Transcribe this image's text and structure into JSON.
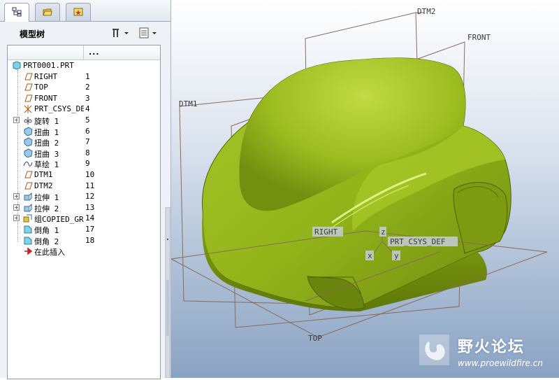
{
  "panel": {
    "title": "模型树",
    "column_header": "..."
  },
  "tree": {
    "root": "PRT0001.PRT",
    "rows": [
      {
        "label": "RIGHT",
        "num": "1",
        "icon": "datum-plane-icon",
        "expand": false
      },
      {
        "label": "TOP",
        "num": "2",
        "icon": "datum-plane-icon",
        "expand": false
      },
      {
        "label": "FRONT",
        "num": "3",
        "icon": "datum-plane-icon",
        "expand": false
      },
      {
        "label": "PRT_CSYS_DEF",
        "num": "4",
        "icon": "csys-icon",
        "expand": false
      },
      {
        "label": "旋转 1",
        "num": "5",
        "icon": "revolve-icon",
        "expand": true
      },
      {
        "label": "扭曲 1",
        "num": "6",
        "icon": "warp-icon",
        "expand": false
      },
      {
        "label": "扭曲 2",
        "num": "7",
        "icon": "warp-icon",
        "expand": false
      },
      {
        "label": "扭曲 3",
        "num": "8",
        "icon": "warp-icon",
        "expand": false
      },
      {
        "label": "草绘 1",
        "num": "9",
        "icon": "sketch-icon",
        "expand": false
      },
      {
        "label": "DTM1",
        "num": "10",
        "icon": "datum-plane-icon",
        "expand": false
      },
      {
        "label": "DTM2",
        "num": "11",
        "icon": "datum-plane-icon",
        "expand": false
      },
      {
        "label": "拉伸 1",
        "num": "12",
        "icon": "extrude-icon",
        "expand": true
      },
      {
        "label": "拉伸 2",
        "num": "13",
        "icon": "extrude-icon",
        "expand": true
      },
      {
        "label": "组COPIED_GROUP",
        "num": "14",
        "icon": "group-icon",
        "expand": true
      },
      {
        "label": "倒角 1",
        "num": "17",
        "icon": "chamfer-icon",
        "expand": false
      },
      {
        "label": "倒角 2",
        "num": "18",
        "icon": "chamfer-icon",
        "expand": false
      },
      {
        "label": "在此插入",
        "num": "",
        "icon": "insert-arrow-icon",
        "expand": false
      }
    ]
  },
  "viewport": {
    "labels": {
      "dtm2": "DTM2",
      "front": "FRONT",
      "dtm1": "DTM1",
      "right": "RIGHT",
      "csys": "PRT_CSYS_DEF",
      "top": "TOP",
      "x": "x",
      "y": "y",
      "z": "z"
    },
    "colors": {
      "model": "#9fc21d",
      "datum": "#8a6a5a"
    }
  },
  "watermark": {
    "title": "野火论坛",
    "url": "www.proewildfire.cn"
  }
}
